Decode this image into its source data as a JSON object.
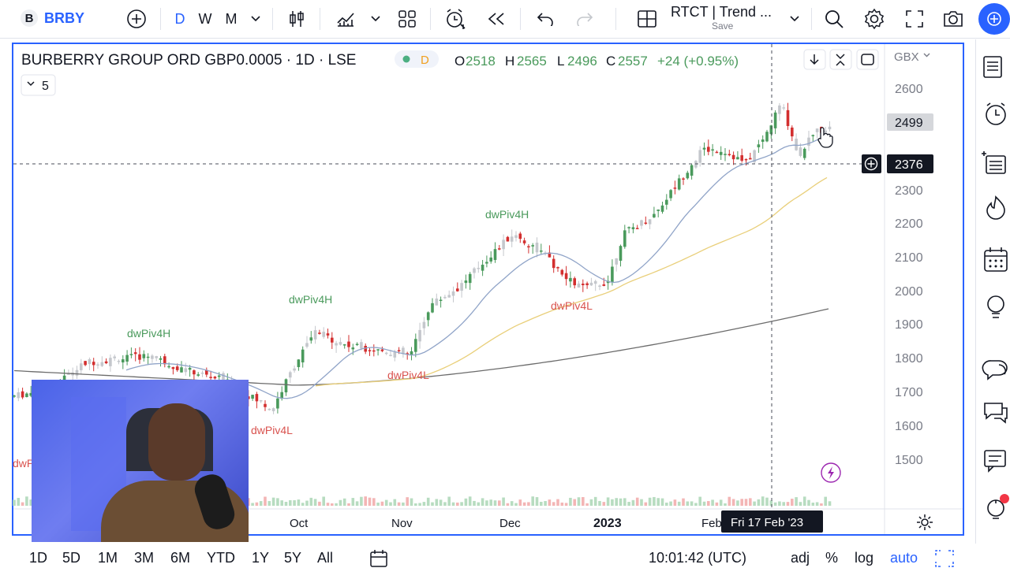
{
  "topbar": {
    "symbol_badge": "B",
    "symbol": "BRBY",
    "intervals": [
      "D",
      "W",
      "M"
    ],
    "layout_title": "RTCT | Trend ...",
    "layout_save": "Save"
  },
  "legend": {
    "title": "BURBERRY GROUP ORD GBP0.0005 · 1D · LSE",
    "badge": "D",
    "open_label": "O",
    "open_value": "2518",
    "high_label": "H",
    "high_value": "2565",
    "low_label": "L",
    "low_value": "2496",
    "close_label": "C",
    "close_value": "2557",
    "change": "+24 (+0.95%)",
    "indicator_count": "5"
  },
  "price_axis": {
    "currency": "GBX",
    "ticks": [
      "2600",
      "2300",
      "2200",
      "2100",
      "2000",
      "1900",
      "1800",
      "1700",
      "1600",
      "1500"
    ],
    "last_price": "2499",
    "crosshair_price": "2376"
  },
  "time_axis": {
    "ticks": [
      "Oct",
      "Nov",
      "Dec",
      "2023",
      "Feb"
    ],
    "crosshair_date": "Fri 17 Feb '23"
  },
  "annotations": [
    {
      "text": "dwPiv4H",
      "type": "high"
    },
    {
      "text": "dwPiv4H",
      "type": "high"
    },
    {
      "text": "dwPiv4H",
      "type": "high"
    },
    {
      "text": "dwPiv4L",
      "type": "low"
    },
    {
      "text": "dwPiv4L",
      "type": "low"
    },
    {
      "text": "dwPiv4L",
      "type": "low"
    },
    {
      "text": "dwPi",
      "type": "low"
    }
  ],
  "bottombar": {
    "ranges": [
      "1D",
      "5D",
      "1M",
      "3M",
      "6M",
      "YTD",
      "1Y",
      "5Y",
      "All"
    ],
    "clock": "10:01:42 (UTC)",
    "adj": "adj",
    "percent": "%",
    "log": "log",
    "auto": "auto"
  },
  "colors": {
    "up": "#4a9a5c",
    "down": "#d32f2f",
    "neutral": "#c4c7cc",
    "accent": "#2962ff",
    "ema_fast": "#90a4c8",
    "ema_mid": "#e9cf7a",
    "sma_slow": "#6b6b6b"
  },
  "icons": [
    "plus-circle-icon",
    "candles-icon",
    "indicators-icon",
    "templates-icon",
    "alert-icon",
    "replay-icon",
    "undo-icon",
    "redo-icon",
    "layout-grid-icon",
    "search-icon",
    "gear-icon",
    "fullscreen-icon",
    "camera-icon",
    "publish-icon",
    "watchlist-icon",
    "alerts-clock-icon",
    "data-window-icon",
    "hotlist-icon",
    "calendar-icon",
    "ideas-icon",
    "streams-icon",
    "chat-icon",
    "notifications-icon",
    "help-icon"
  ]
}
